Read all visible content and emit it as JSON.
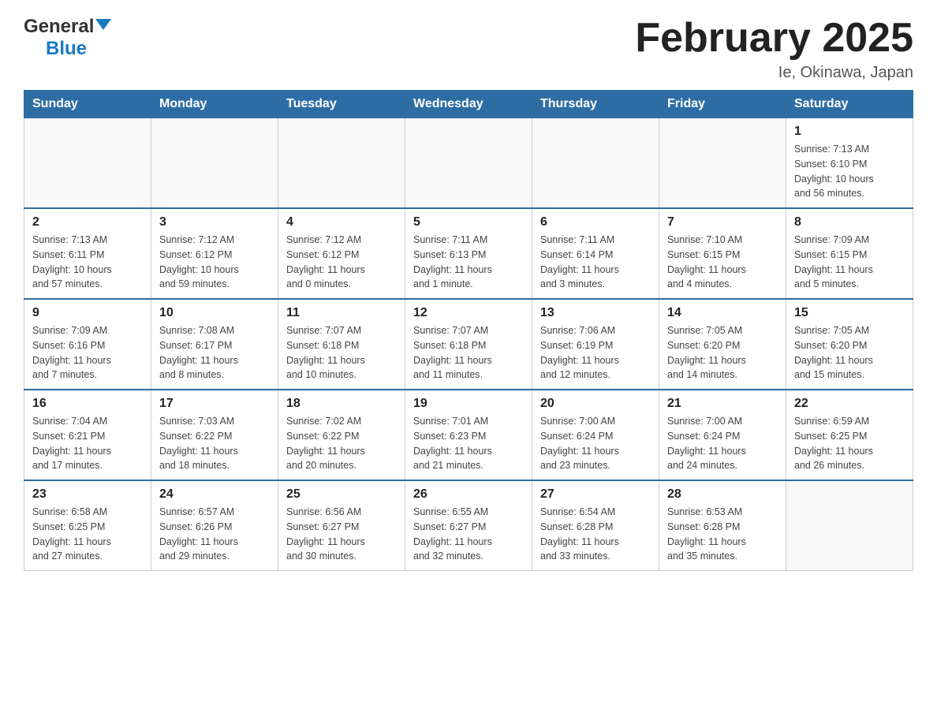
{
  "logo": {
    "general": "General",
    "blue": "Blue"
  },
  "title": "February 2025",
  "subtitle": "Ie, Okinawa, Japan",
  "weekdays": [
    "Sunday",
    "Monday",
    "Tuesday",
    "Wednesday",
    "Thursday",
    "Friday",
    "Saturday"
  ],
  "weeks": [
    [
      {
        "day": "",
        "info": ""
      },
      {
        "day": "",
        "info": ""
      },
      {
        "day": "",
        "info": ""
      },
      {
        "day": "",
        "info": ""
      },
      {
        "day": "",
        "info": ""
      },
      {
        "day": "",
        "info": ""
      },
      {
        "day": "1",
        "info": "Sunrise: 7:13 AM\nSunset: 6:10 PM\nDaylight: 10 hours\nand 56 minutes."
      }
    ],
    [
      {
        "day": "2",
        "info": "Sunrise: 7:13 AM\nSunset: 6:11 PM\nDaylight: 10 hours\nand 57 minutes."
      },
      {
        "day": "3",
        "info": "Sunrise: 7:12 AM\nSunset: 6:12 PM\nDaylight: 10 hours\nand 59 minutes."
      },
      {
        "day": "4",
        "info": "Sunrise: 7:12 AM\nSunset: 6:12 PM\nDaylight: 11 hours\nand 0 minutes."
      },
      {
        "day": "5",
        "info": "Sunrise: 7:11 AM\nSunset: 6:13 PM\nDaylight: 11 hours\nand 1 minute."
      },
      {
        "day": "6",
        "info": "Sunrise: 7:11 AM\nSunset: 6:14 PM\nDaylight: 11 hours\nand 3 minutes."
      },
      {
        "day": "7",
        "info": "Sunrise: 7:10 AM\nSunset: 6:15 PM\nDaylight: 11 hours\nand 4 minutes."
      },
      {
        "day": "8",
        "info": "Sunrise: 7:09 AM\nSunset: 6:15 PM\nDaylight: 11 hours\nand 5 minutes."
      }
    ],
    [
      {
        "day": "9",
        "info": "Sunrise: 7:09 AM\nSunset: 6:16 PM\nDaylight: 11 hours\nand 7 minutes."
      },
      {
        "day": "10",
        "info": "Sunrise: 7:08 AM\nSunset: 6:17 PM\nDaylight: 11 hours\nand 8 minutes."
      },
      {
        "day": "11",
        "info": "Sunrise: 7:07 AM\nSunset: 6:18 PM\nDaylight: 11 hours\nand 10 minutes."
      },
      {
        "day": "12",
        "info": "Sunrise: 7:07 AM\nSunset: 6:18 PM\nDaylight: 11 hours\nand 11 minutes."
      },
      {
        "day": "13",
        "info": "Sunrise: 7:06 AM\nSunset: 6:19 PM\nDaylight: 11 hours\nand 12 minutes."
      },
      {
        "day": "14",
        "info": "Sunrise: 7:05 AM\nSunset: 6:20 PM\nDaylight: 11 hours\nand 14 minutes."
      },
      {
        "day": "15",
        "info": "Sunrise: 7:05 AM\nSunset: 6:20 PM\nDaylight: 11 hours\nand 15 minutes."
      }
    ],
    [
      {
        "day": "16",
        "info": "Sunrise: 7:04 AM\nSunset: 6:21 PM\nDaylight: 11 hours\nand 17 minutes."
      },
      {
        "day": "17",
        "info": "Sunrise: 7:03 AM\nSunset: 6:22 PM\nDaylight: 11 hours\nand 18 minutes."
      },
      {
        "day": "18",
        "info": "Sunrise: 7:02 AM\nSunset: 6:22 PM\nDaylight: 11 hours\nand 20 minutes."
      },
      {
        "day": "19",
        "info": "Sunrise: 7:01 AM\nSunset: 6:23 PM\nDaylight: 11 hours\nand 21 minutes."
      },
      {
        "day": "20",
        "info": "Sunrise: 7:00 AM\nSunset: 6:24 PM\nDaylight: 11 hours\nand 23 minutes."
      },
      {
        "day": "21",
        "info": "Sunrise: 7:00 AM\nSunset: 6:24 PM\nDaylight: 11 hours\nand 24 minutes."
      },
      {
        "day": "22",
        "info": "Sunrise: 6:59 AM\nSunset: 6:25 PM\nDaylight: 11 hours\nand 26 minutes."
      }
    ],
    [
      {
        "day": "23",
        "info": "Sunrise: 6:58 AM\nSunset: 6:25 PM\nDaylight: 11 hours\nand 27 minutes."
      },
      {
        "day": "24",
        "info": "Sunrise: 6:57 AM\nSunset: 6:26 PM\nDaylight: 11 hours\nand 29 minutes."
      },
      {
        "day": "25",
        "info": "Sunrise: 6:56 AM\nSunset: 6:27 PM\nDaylight: 11 hours\nand 30 minutes."
      },
      {
        "day": "26",
        "info": "Sunrise: 6:55 AM\nSunset: 6:27 PM\nDaylight: 11 hours\nand 32 minutes."
      },
      {
        "day": "27",
        "info": "Sunrise: 6:54 AM\nSunset: 6:28 PM\nDaylight: 11 hours\nand 33 minutes."
      },
      {
        "day": "28",
        "info": "Sunrise: 6:53 AM\nSunset: 6:28 PM\nDaylight: 11 hours\nand 35 minutes."
      },
      {
        "day": "",
        "info": ""
      }
    ]
  ],
  "accent_color": "#2e6da4"
}
